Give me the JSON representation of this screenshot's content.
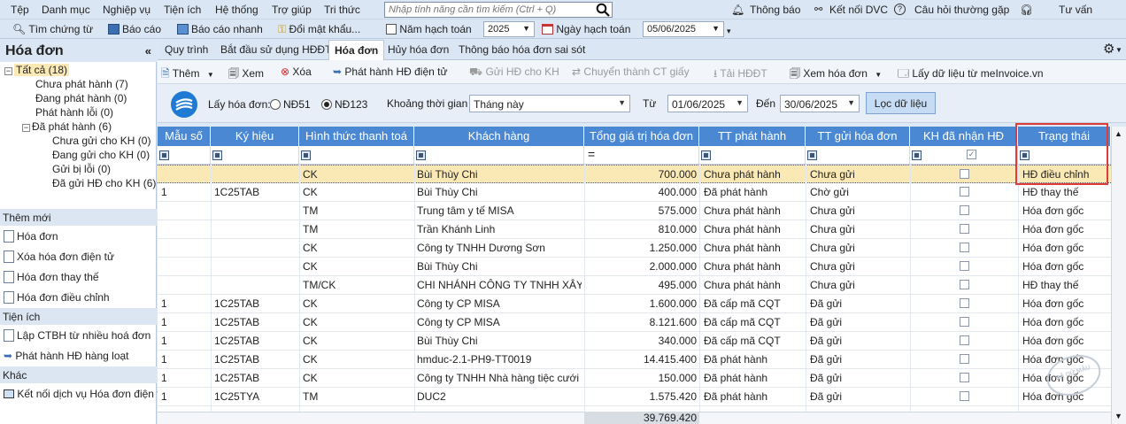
{
  "menubar": {
    "items": [
      "Tệp",
      "Danh mục",
      "Nghiệp vụ",
      "Tiện ích",
      "Hệ thống",
      "Trợ giúp",
      "Tri thức"
    ],
    "search_placeholder": "Nhập tính năng cần tìm kiếm (Ctrl + Q)",
    "right": {
      "notify": "Thông báo",
      "dvc": "Kết nối DVC",
      "faq": "Câu hỏi thường gặp",
      "advice": "Tư vấn"
    }
  },
  "toolbar": {
    "find": "Tìm chứng từ",
    "report": "Báo cáo",
    "quick_report": "Báo cáo nhanh",
    "change_pwd": "Đổi mật khẩu...",
    "fiscal_year_label": "Năm hạch toán",
    "fiscal_year": "2025",
    "posting_date_label": "Ngày hạch toán",
    "posting_date": "05/06/2025"
  },
  "left_panel": {
    "title": "Hóa đơn",
    "collapse": "«",
    "tree": {
      "all": "Tất cả (18)",
      "not_issued": "Chưa phát hành (7)",
      "issuing": "Đang phát hành (0)",
      "issue_error": "Phát hành lỗi (0)",
      "issued": "Đã phát hành (6)",
      "not_sent": "Chưa gửi cho KH (0)",
      "sending": "Đang gửi cho KH (0)",
      "send_error": "Gửi bị lỗi (0)",
      "sent": "Đã gửi HĐ cho KH (6)"
    },
    "section_new": "Thêm mới",
    "new_items": [
      "Hóa đơn",
      "Xóa hóa đơn điện tử",
      "Hóa đơn thay thế",
      "Hóa đơn điều chỉnh"
    ],
    "section_util": "Tiện ích",
    "util_items": [
      "Lập CTBH từ nhiều hoá đơn",
      "Phát hành HĐ hàng loạt"
    ],
    "section_other": "Khác",
    "other_items": [
      "Kết nối dịch vụ Hóa đơn điện t"
    ]
  },
  "tabs": [
    "Quy trình",
    "Bắt đầu sử dụng HĐĐT",
    "Hóa đơn",
    "Hủy hóa đơn",
    "Thông báo hóa đơn sai sót"
  ],
  "actions": {
    "add": "Thêm",
    "view": "Xem",
    "delete": "Xóa",
    "issue": "Phát hành HĐ điện tử",
    "send": "Gửi HĐ cho KH",
    "convert": "Chuyển thành CT giấy",
    "download": "Tải HĐĐT",
    "view_invoice": "Xem hóa đơn",
    "fetch": "Lấy dữ liệu từ meInvoice.vn"
  },
  "filter": {
    "get_label": "Lấy hóa đơn:",
    "opt1": "NĐ51",
    "opt2": "NĐ123",
    "period_label": "Khoảng thời gian",
    "period": "Tháng này",
    "from_label": "Từ",
    "from": "01/06/2025",
    "to_label": "Đến",
    "to": "30/06/2025",
    "button": "Lọc dữ liệu"
  },
  "table": {
    "columns": [
      "Mẫu số",
      "Ký hiệu",
      "Hình thức thanh toá",
      "Khách hàng",
      "Tổng giá trị hóa đơn",
      "TT phát hành",
      "TT gửi hóa đơn",
      "KH đã nhận HĐ",
      "Trạng thái"
    ],
    "filter_eq": "=",
    "rows": [
      {
        "mau": "",
        "kh": "",
        "httt": "CK",
        "khach": "Bùi Thùy Chi",
        "tong": "700.000",
        "ttph": "Chưa phát hành",
        "ttgui": "Chưa gửi",
        "nhan": true,
        "tt": "HĐ điều chỉnh"
      },
      {
        "mau": "1",
        "kh": "1C25TAB",
        "httt": "CK",
        "khach": "Bùi Thùy Chi",
        "tong": "400.000",
        "ttph": "Đã phát hành",
        "ttgui": "Chờ gửi",
        "nhan": false,
        "tt": "HĐ thay thế"
      },
      {
        "mau": "",
        "kh": "",
        "httt": "TM",
        "khach": "Trung tâm y tế MISA",
        "tong": "575.000",
        "ttph": "Chưa phát hành",
        "ttgui": "Chưa gửi",
        "nhan": false,
        "tt": "Hóa đơn gốc"
      },
      {
        "mau": "",
        "kh": "",
        "httt": "TM",
        "khach": "Trần Khánh Linh",
        "tong": "810.000",
        "ttph": "Chưa phát hành",
        "ttgui": "Chưa gửi",
        "nhan": false,
        "tt": "Hóa đơn gốc"
      },
      {
        "mau": "",
        "kh": "",
        "httt": "CK",
        "khach": "Công ty TNHH Dương Sơn",
        "tong": "1.250.000",
        "ttph": "Chưa phát hành",
        "ttgui": "Chưa gửi",
        "nhan": false,
        "tt": "Hóa đơn gốc"
      },
      {
        "mau": "",
        "kh": "",
        "httt": "CK",
        "khach": "Bùi Thùy Chi",
        "tong": "2.000.000",
        "ttph": "Chưa phát hành",
        "ttgui": "Chưa gửi",
        "nhan": false,
        "tt": "Hóa đơn gốc"
      },
      {
        "mau": "",
        "kh": "",
        "httt": "TM/CK",
        "khach": "CHI NHÁNH CÔNG TY TNHH XÂY",
        "tong": "495.000",
        "ttph": "Chưa phát hành",
        "ttgui": "Chưa gửi",
        "nhan": false,
        "tt": "HĐ thay thế"
      },
      {
        "mau": "1",
        "kh": "1C25TAB",
        "httt": "CK",
        "khach": "Công ty CP MISA",
        "tong": "1.600.000",
        "ttph": "Đã cấp mã CQT",
        "ttgui": "Đã gửi",
        "nhan": false,
        "tt": "Hóa đơn gốc"
      },
      {
        "mau": "1",
        "kh": "1C25TAB",
        "httt": "CK",
        "khach": "Công ty CP MISA",
        "tong": "8.121.600",
        "ttph": "Đã cấp mã CQT",
        "ttgui": "Đã gửi",
        "nhan": false,
        "tt": "Hóa đơn gốc"
      },
      {
        "mau": "1",
        "kh": "1C25TAB",
        "httt": "CK",
        "khach": "Bùi Thùy Chi",
        "tong": "340.000",
        "ttph": "Đã cấp mã CQT",
        "ttgui": "Đã gửi",
        "nhan": false,
        "tt": "Hóa đơn gốc"
      },
      {
        "mau": "1",
        "kh": "1C25TAB",
        "httt": "CK",
        "khach": "hmduc-2.1-PH9-TT0019",
        "tong": "14.415.400",
        "ttph": "Đã phát hành",
        "ttgui": "Đã gửi",
        "nhan": false,
        "tt": "Hóa đơn gốc"
      },
      {
        "mau": "1",
        "kh": "1C25TAB",
        "httt": "CK",
        "khach": "Công ty TNHH Nhà hàng tiệc cưới C",
        "tong": "150.000",
        "ttph": "Đã phát hành",
        "ttgui": "Đã gửi",
        "nhan": false,
        "tt": "Hóa đơn gốc"
      },
      {
        "mau": "1",
        "kh": "1C25TYA",
        "httt": "TM",
        "khach": "DUC2",
        "tong": "1.575.420",
        "ttph": "Đã phát hành",
        "ttgui": "Đã gửi",
        "nhan": false,
        "tt": "Hóa đơn gốc"
      }
    ],
    "total": "39.769.420"
  },
  "watermark": "ĐÃ DỮ MÃU",
  "colors": {
    "header": "#4a88d4",
    "selected_row": "#fbe9b5",
    "highlight_border": "#e03a3a"
  }
}
